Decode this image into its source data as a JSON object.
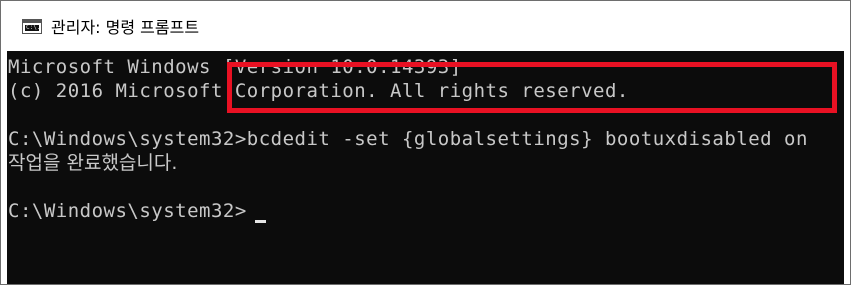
{
  "window": {
    "icon": "command-prompt-icon",
    "icon_text": "C:\\.",
    "title": "관리자: 명령 프롬프트"
  },
  "console": {
    "lines": [
      "Microsoft Windows [Version 10.0.14393]",
      "(c) 2016 Microsoft Corporation. All rights reserved.",
      "",
      "C:\\Windows\\system32>bcdedit -set {globalsettings} bootuxdisabled on",
      "작업을 완료했습니다.",
      "",
      "C:\\Windows\\system32>"
    ]
  },
  "annotation": {
    "highlight_color": "#e81123"
  },
  "colors": {
    "console_bg": "#0c0c0c",
    "console_text": "#c8c8c8",
    "title_bg": "#ffffff"
  }
}
